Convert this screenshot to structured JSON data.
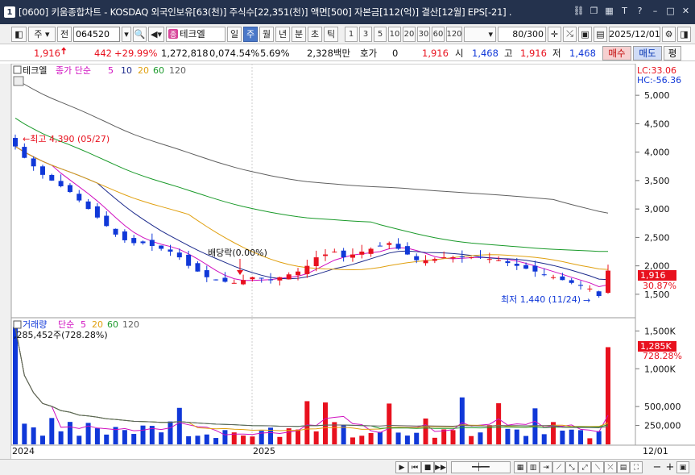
{
  "window": {
    "number": "1",
    "title": "[0600] 키움종합차트 - KOSDAQ 외국인보유[63(천)] 주식수[22,351(천)] 액면[500] 자본금[112(억)] 결산[12월] EPS[-21] ."
  },
  "toolbar": {
    "period_type": "주",
    "prev_label": "전",
    "stock_code": "064520",
    "stock_name": "테크엘",
    "name_badge": "종",
    "period_buttons": [
      "일",
      "주",
      "월",
      "년",
      "분",
      "초",
      "틱"
    ],
    "selected_period": "주",
    "numeric_buttons": [
      "1",
      "3",
      "5",
      "10",
      "20",
      "30",
      "60",
      "120"
    ],
    "count": "80",
    "count_max": "/300",
    "date": "2025/12/01"
  },
  "quote": {
    "price": "1,916",
    "change": "442",
    "change_rate": "+29.99%",
    "volume": "1,272,818",
    "volume_ratio": "0,074.54%",
    "turnover": "5.69%",
    "amount": "2,328백만",
    "hoga_label": "호가",
    "hoga_value": "0",
    "hoga_price": "1,916",
    "open_label": "시",
    "open": "1,468",
    "high_label": "고",
    "high": "1,916",
    "low_label": "저",
    "low": "1,468",
    "buy_label": "매수",
    "sell_label": "매도",
    "eval_label": "평"
  },
  "price_panel": {
    "stock_label": "테크엘",
    "ma_legend": {
      "label": "종가 단순",
      "periods": [
        "5",
        "10",
        "20",
        "60",
        "120"
      ]
    },
    "lc_label": "LC:33.06",
    "hc_label": "HC:-56.36",
    "high_note": "최고 4,390 (05/27)",
    "low_note": "최저 1,440 (11/24)",
    "dividend_note": "배당락(0.00%)",
    "current_price_tag": "1,916",
    "current_pct_tag": "30.87%",
    "y_ticks": [
      "5,000",
      "4,500",
      "4,000",
      "3,500",
      "3,000",
      "2,500",
      "2,000",
      "1,500"
    ]
  },
  "volume_panel": {
    "legend_label": "거래량",
    "ma_label": "단순",
    "periods": [
      "5",
      "20",
      "60",
      "120"
    ],
    "current_note": ",285,452주(728.28%)",
    "current_tag": "1,285K",
    "current_pct_tag": "728.28%",
    "y_ticks": [
      "1,500K",
      "1,000K",
      "500,000",
      "250,000"
    ]
  },
  "x_axis": {
    "labels": [
      "2024",
      "2025"
    ],
    "last_date": "12/01"
  },
  "colors": {
    "up": "#e8111e",
    "down": "#1038d8",
    "ma5": "#d010c0",
    "ma10": "#1c2a8c",
    "ma20": "#e0a010",
    "ma60": "#1a9a2a",
    "ma120": "#606060"
  },
  "chart_data": {
    "type": "candlestick",
    "weekly_close_trend": [
      4100,
      3900,
      3750,
      3600,
      3500,
      3400,
      3300,
      3150,
      3000,
      2850,
      2700,
      2550,
      2450,
      2400,
      2400,
      2350,
      2300,
      2250,
      2150,
      2000,
      1900,
      1800,
      1750,
      1720,
      1700,
      1750,
      1800,
      1780,
      1760,
      1800,
      1850,
      1900,
      2000,
      2150,
      2200,
      2250,
      2150,
      2200,
      2250,
      2300,
      2350,
      2400,
      2300,
      2200,
      2100,
      2100,
      2120,
      2150,
      2150,
      2150,
      2150,
      2150,
      2120,
      2100,
      2050,
      2000,
      1950,
      1900,
      1850,
      1800,
      1750,
      1700,
      1650,
      1600,
      1470,
      1916
    ],
    "max_price": {
      "value": 4390,
      "date": "05/27"
    },
    "min_price": {
      "value": 1440,
      "date": "11/24"
    },
    "last_volume": 1285452,
    "y_range": [
      1300,
      5300
    ],
    "volume_range": [
      0,
      1600000
    ]
  }
}
